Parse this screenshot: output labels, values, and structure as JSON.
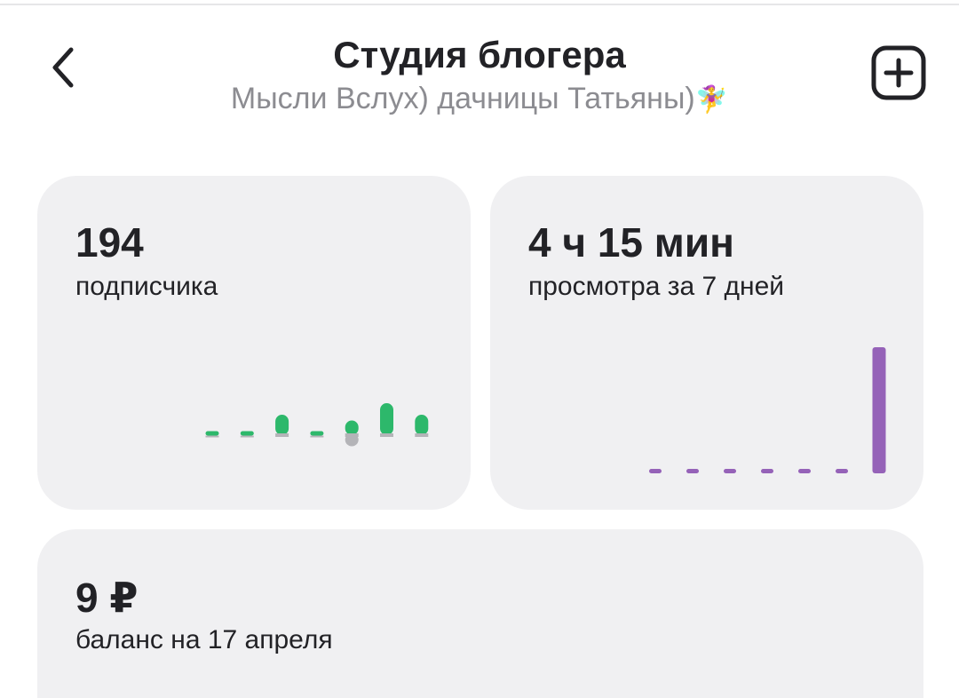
{
  "header": {
    "title": "Студия блогера",
    "subtitle": "Мысли Вслух) дачницы Татьяны)",
    "subtitle_emoji": "🧚‍♀️",
    "back_icon": "chevron-left-icon",
    "add_icon": "plus-square-icon"
  },
  "cards": {
    "subscribers": {
      "value": "194",
      "label": "подписчика",
      "accent": "#2db86b",
      "negative_color": "#b4b4b8"
    },
    "views": {
      "value": "4 ч 15 мин",
      "label": "просмотра за 7 дней",
      "accent": "#9562b8"
    },
    "balance": {
      "value": "9 ₽",
      "label": "баланс на 17 апреля"
    }
  },
  "chart_data": [
    {
      "type": "bar",
      "categories": [
        "1",
        "2",
        "3",
        "4",
        "5",
        "6",
        "7"
      ],
      "series": [
        {
          "values": [
            0,
            0,
            2,
            0,
            1,
            4,
            2
          ]
        },
        {
          "values": [
            0,
            0,
            0,
            0,
            -1,
            0,
            0
          ]
        }
      ],
      "title": "",
      "xlabel": "",
      "ylabel": ""
    },
    {
      "type": "bar",
      "categories": [
        "1",
        "2",
        "3",
        "4",
        "5",
        "6",
        "7"
      ],
      "values": [
        0,
        0,
        0,
        0,
        0,
        0,
        255
      ],
      "title": "",
      "xlabel": "",
      "ylabel": ""
    }
  ]
}
